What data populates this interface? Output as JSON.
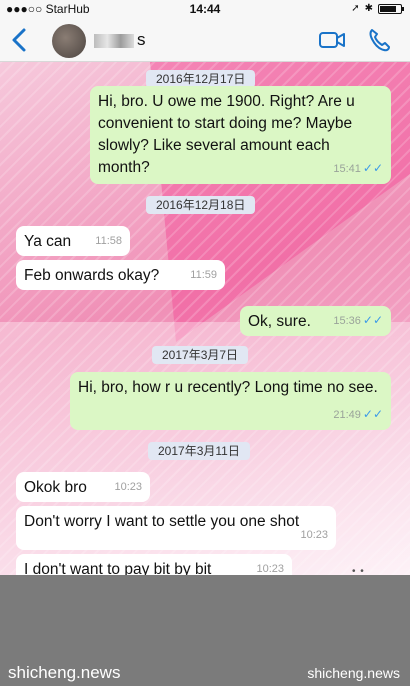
{
  "status": {
    "carrier": "●●●○○ StarHub",
    "time": "14:44"
  },
  "header": {
    "contact_name": "s",
    "back_icon": "chevron-left-icon",
    "video_icon": "video-camera-icon",
    "call_icon": "phone-icon",
    "accent": "#1a73c8"
  },
  "messages": [
    {
      "kind": "date",
      "text": "2016年12月17日"
    },
    {
      "kind": "out",
      "text": "Hi, bro. U owe me 1900. Right? Are u convenient to start doing me? Maybe slowly? Like several amount each month?",
      "time": "15:41"
    },
    {
      "kind": "date",
      "text": "2016年12月18日"
    },
    {
      "kind": "in",
      "text": "Ya can",
      "time": "11:58"
    },
    {
      "kind": "in",
      "text": "Feb onwards okay?",
      "time": "11:59"
    },
    {
      "kind": "out",
      "text": "Ok, sure.",
      "time": "15:36"
    },
    {
      "kind": "date",
      "text": "2017年3月7日"
    },
    {
      "kind": "out",
      "text": "Hi, bro, how r u recently? Long time no see.",
      "time": "21:49"
    },
    {
      "kind": "date",
      "text": "2017年3月11日"
    },
    {
      "kind": "in",
      "text": "Okok bro",
      "time": "10:23"
    },
    {
      "kind": "in",
      "text": "Don't worry I want to settle you one shot",
      "time": "10:23"
    },
    {
      "kind": "in",
      "text": "I don't want to pay bit by bit",
      "time": "10:23"
    }
  ],
  "watermark": {
    "left": "shicheng.news",
    "right": "shicheng.news"
  },
  "colors": {
    "bubble_out": "#dbf7c5",
    "bubble_in": "#ffffff",
    "date_chip": "#e1e7f3",
    "read_ticks": "#3c9ae8"
  }
}
